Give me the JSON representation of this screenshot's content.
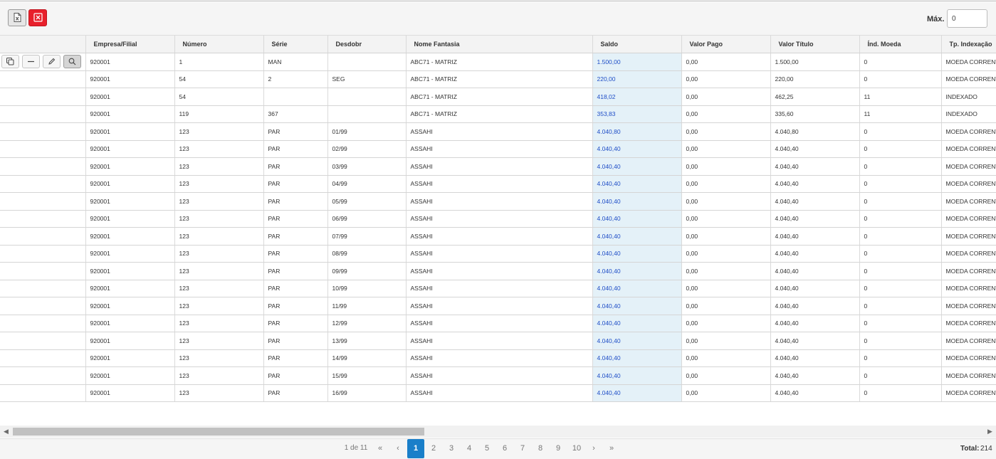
{
  "toolbar": {
    "excel_icon": "excel-export-icon",
    "close_icon": "close-grid-icon",
    "max_label": "Máx.",
    "max_value": "0",
    "accent_red": "#e8202b"
  },
  "table": {
    "columns": [
      "",
      "Empresa/Filial",
      "Número",
      "Série",
      "Desdobr",
      "Nome Fantasia",
      "Saldo",
      "Valor Pago",
      "Valor Título",
      "Índ. Moeda",
      "Tp. Indexação"
    ],
    "row_actions": [
      "copy-icon",
      "minus-icon",
      "pencil-icon",
      "search-icon"
    ],
    "rows": [
      [
        "920001",
        "1",
        "MAN",
        "",
        "ABC71 - MATRIZ",
        "1.500,00",
        "0,00",
        "1.500,00",
        "0",
        "MOEDA CORRENTE"
      ],
      [
        "920001",
        "54",
        "2",
        "SEG",
        "ABC71 - MATRIZ",
        "220,00",
        "0,00",
        "220,00",
        "0",
        "MOEDA CORRENTE"
      ],
      [
        "920001",
        "54",
        "",
        "",
        "ABC71 - MATRIZ",
        "418,02",
        "0,00",
        "462,25",
        "11",
        "INDEXADO"
      ],
      [
        "920001",
        "119",
        "367",
        "",
        "ABC71 - MATRIZ",
        "353,83",
        "0,00",
        "335,60",
        "11",
        "INDEXADO"
      ],
      [
        "920001",
        "123",
        "PAR",
        "01/99",
        "ASSAHI",
        "4.040,80",
        "0,00",
        "4.040,80",
        "0",
        "MOEDA CORRENTE"
      ],
      [
        "920001",
        "123",
        "PAR",
        "02/99",
        "ASSAHI",
        "4.040,40",
        "0,00",
        "4.040,40",
        "0",
        "MOEDA CORRENTE"
      ],
      [
        "920001",
        "123",
        "PAR",
        "03/99",
        "ASSAHI",
        "4.040,40",
        "0,00",
        "4.040,40",
        "0",
        "MOEDA CORRENTE"
      ],
      [
        "920001",
        "123",
        "PAR",
        "04/99",
        "ASSAHI",
        "4.040,40",
        "0,00",
        "4.040,40",
        "0",
        "MOEDA CORRENTE"
      ],
      [
        "920001",
        "123",
        "PAR",
        "05/99",
        "ASSAHI",
        "4.040,40",
        "0,00",
        "4.040,40",
        "0",
        "MOEDA CORRENTE"
      ],
      [
        "920001",
        "123",
        "PAR",
        "06/99",
        "ASSAHI",
        "4.040,40",
        "0,00",
        "4.040,40",
        "0",
        "MOEDA CORRENTE"
      ],
      [
        "920001",
        "123",
        "PAR",
        "07/99",
        "ASSAHI",
        "4.040,40",
        "0,00",
        "4.040,40",
        "0",
        "MOEDA CORRENTE"
      ],
      [
        "920001",
        "123",
        "PAR",
        "08/99",
        "ASSAHI",
        "4.040,40",
        "0,00",
        "4.040,40",
        "0",
        "MOEDA CORRENTE"
      ],
      [
        "920001",
        "123",
        "PAR",
        "09/99",
        "ASSAHI",
        "4.040,40",
        "0,00",
        "4.040,40",
        "0",
        "MOEDA CORRENTE"
      ],
      [
        "920001",
        "123",
        "PAR",
        "10/99",
        "ASSAHI",
        "4.040,40",
        "0,00",
        "4.040,40",
        "0",
        "MOEDA CORRENTE"
      ],
      [
        "920001",
        "123",
        "PAR",
        "11/99",
        "ASSAHI",
        "4.040,40",
        "0,00",
        "4.040,40",
        "0",
        "MOEDA CORRENTE"
      ],
      [
        "920001",
        "123",
        "PAR",
        "12/99",
        "ASSAHI",
        "4.040,40",
        "0,00",
        "4.040,40",
        "0",
        "MOEDA CORRENTE"
      ],
      [
        "920001",
        "123",
        "PAR",
        "13/99",
        "ASSAHI",
        "4.040,40",
        "0,00",
        "4.040,40",
        "0",
        "MOEDA CORRENTE"
      ],
      [
        "920001",
        "123",
        "PAR",
        "14/99",
        "ASSAHI",
        "4.040,40",
        "0,00",
        "4.040,40",
        "0",
        "MOEDA CORRENTE"
      ],
      [
        "920001",
        "123",
        "PAR",
        "15/99",
        "ASSAHI",
        "4.040,40",
        "0,00",
        "4.040,40",
        "0",
        "MOEDA CORRENTE"
      ],
      [
        "920001",
        "123",
        "PAR",
        "16/99",
        "ASSAHI",
        "4.040,40",
        "0,00",
        "4.040,40",
        "0",
        "MOEDA CORRENTE"
      ]
    ]
  },
  "scrollbar": {
    "left_arrow": "◀",
    "right_arrow": "▶"
  },
  "pagination": {
    "info": "1 de 11",
    "first": "«",
    "prev": "‹",
    "pages": [
      "1",
      "2",
      "3",
      "4",
      "5",
      "6",
      "7",
      "8",
      "9",
      "10"
    ],
    "current": "1",
    "next": "›",
    "last": "»",
    "total_label": "Total:",
    "total_value": "214",
    "accent_blue": "#1a7fc9"
  }
}
